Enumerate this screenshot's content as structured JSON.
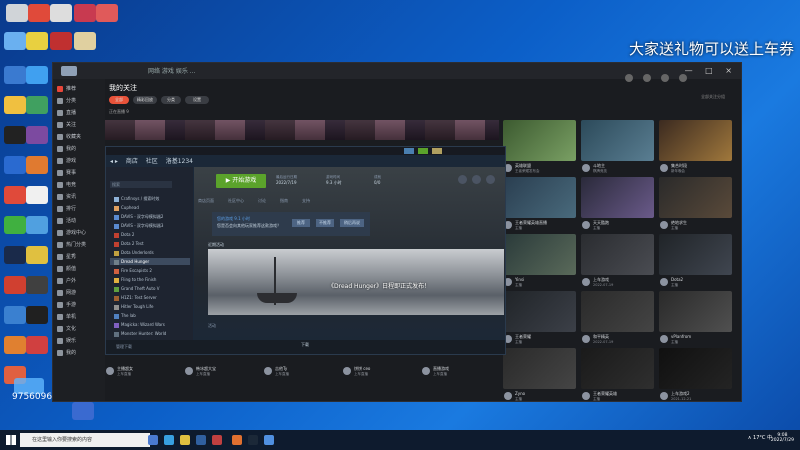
{
  "overlay": {
    "banner": "大家送礼物可以送上车券",
    "room_id": "9756096"
  },
  "window": {
    "brand": "斗鱼",
    "top_tabs": "网络 游戏 娱乐 ...",
    "controls": "— □ ×",
    "follow_title": "我的关注",
    "filters": [
      "全部",
      "精彩回放",
      "分类",
      "设置"
    ],
    "live_label": "正在直播 9",
    "right_label": "全部关注分组",
    "nav": [
      "推荐",
      "分类",
      "直播",
      "关注",
      "收藏夹",
      "我的",
      "游戏",
      "赛事",
      "电竞",
      "资讯",
      "排行",
      "活动",
      "游戏中心",
      "热门分类",
      "星秀",
      "颜值",
      "户外",
      "网游",
      "手游",
      "单机",
      "文化",
      "娱乐",
      "我的"
    ]
  },
  "grid": [
    {
      "name": "英雄联盟",
      "sub": "王者荣耀发布会",
      "colors": "#3c5a30,#7aa064"
    },
    {
      "name": "斗地主",
      "sub": "棋牌竞技",
      "colors": "#2c4a5a,#5a7e92"
    },
    {
      "name": "集合时段",
      "sub": "新年晚会",
      "colors": "#3b2a20,#a0783c"
    },
    {
      "name": "王者荣耀英雄直播",
      "sub": "主播",
      "colors": "#2a3e50,#496a7c"
    },
    {
      "name": "天天酷跑",
      "sub": "主播",
      "colors": "#2a2a3a,#6a5a8a"
    },
    {
      "name": "绝地求生",
      "sub": "主播",
      "colors": "#2a2a2a,#5a4a3a"
    },
    {
      "name": "Yinsi",
      "sub": "主播",
      "colors": "#2a3a3a,#5a6a5a"
    },
    {
      "name": "上车游戏",
      "sub": "2022-07-19",
      "colors": "#2a2c30,#4a4c52"
    },
    {
      "name": "Dota2",
      "sub": "主播",
      "colors": "#202428,#404650"
    },
    {
      "name": "王者荣耀",
      "sub": "主播",
      "colors": "#202428,#3c4048"
    },
    {
      "name": "和平精英",
      "sub": "2022-07-19",
      "colors": "#2a2a2a,#444"
    },
    {
      "name": "vPlanfrom",
      "sub": "主播",
      "colors": "#2a2a2a,#505050"
    },
    {
      "name": "Zyno",
      "sub": "主播",
      "colors": "#2a2a2a,#454545"
    },
    {
      "name": "王者荣耀英雄",
      "sub": "主播",
      "colors": "#1a1a1a,#2f2f2f"
    },
    {
      "name": "上车游戏2",
      "sub": "2021-12-21",
      "colors": "#101010,#242424"
    },
    {
      "name": "上车直播",
      "sub": "2021-07-19",
      "colors": "#101010,#262626"
    },
    {
      "name": "PK",
      "sub": "主播",
      "colors": "#2a2a2a,#464646"
    },
    {
      "name": "王者荣耀主播",
      "sub": "主播",
      "colors": "#2a2a2a,#3a3a3a"
    },
    {
      "name": "WAR游戏",
      "sub": "主播",
      "colors": "#2a2a2a,#3a3a3a"
    }
  ],
  "bottom": [
    {
      "name": "主播超女",
      "sub": "上车直播"
    },
    {
      "name": "韩冰超大宝",
      "sub": "上车直播"
    },
    {
      "name": "吉他Ty",
      "sub": "上车直播"
    },
    {
      "name": "饼饼 ceo",
      "sub": "上车直播"
    },
    {
      "name": "直播游戏",
      "sub": "上车直播"
    }
  ],
  "steam": {
    "nav": [
      "商店",
      "社区",
      "洛基1234"
    ],
    "search_placeholder": "搜索",
    "play_label": "▶ 开始游戏",
    "stats": [
      {
        "label": "最后运行日期",
        "value": "2022/7/19"
      },
      {
        "label": "游戏时间",
        "value": "9.3 小时"
      },
      {
        "label": "成就",
        "value": "0/0"
      }
    ],
    "tabs": [
      "商店页面",
      "社区中心",
      "讨论",
      "指南",
      "支持"
    ],
    "notice_title": "您的游戏 9.1 小时",
    "notice_text": "您是否会向其他玩家推荐这款游戏？",
    "notice_buttons": [
      "推荐",
      "不推荐",
      "稍后再说"
    ],
    "news_label": "近期活动",
    "news_text": "《Dread Hunger》日程即正式发布！",
    "below_text": "活动",
    "footer_left": "管理下载",
    "footer_center": "下载",
    "library": [
      {
        "label": "Crafinsys / 搜索时效",
        "color": "#8fb3d9"
      },
      {
        "label": "Cuphead",
        "color": "#e0a060"
      },
      {
        "label": "DAVIS - 双字母模拟器2",
        "color": "#5a8ad0"
      },
      {
        "label": "DAVIS - 双字母模拟器3",
        "color": "#5a8ad0"
      },
      {
        "label": "Dota 2",
        "color": "#c04030"
      },
      {
        "label": "Dota 2 Test",
        "color": "#c04030"
      },
      {
        "label": "Dota Underlords",
        "color": "#c0a040"
      },
      {
        "label": "Dread Hunger",
        "color": "#70808a"
      },
      {
        "label": "Fire Escapists 2",
        "color": "#d06040"
      },
      {
        "label": "Fling to the Finish",
        "color": "#e0b040"
      },
      {
        "label": "Grand Theft Auto V",
        "color": "#60a040"
      },
      {
        "label": "H1Z1: Test Server",
        "color": "#a06030"
      },
      {
        "label": "Hitler Tough Life",
        "color": "#909090"
      },
      {
        "label": "The lab",
        "color": "#5080c0"
      },
      {
        "label": "Magicka: Wizard Wars",
        "color": "#8060c0"
      },
      {
        "label": "Monster Hunter: World",
        "color": "#607080"
      }
    ]
  },
  "taskbar": {
    "search_placeholder": "在这里输入你要搜索的内容",
    "tray": "∧ 17°C 中",
    "time": "9:08",
    "date": "2022/7/29"
  }
}
